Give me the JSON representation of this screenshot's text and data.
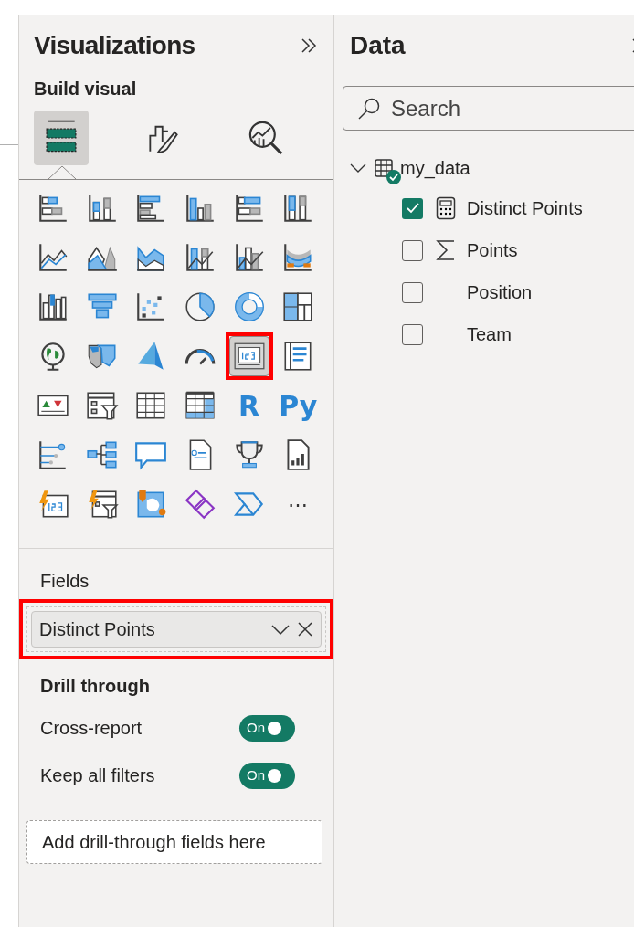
{
  "visualizations": {
    "title": "Visualizations",
    "section": "Build visual",
    "tabs": [
      {
        "kind": "build",
        "selected": true
      },
      {
        "kind": "format",
        "selected": false
      },
      {
        "kind": "analytics",
        "selected": false
      }
    ],
    "visuals": [
      {
        "kind": "stacked-bar",
        "selected": false
      },
      {
        "kind": "stacked-column",
        "selected": false
      },
      {
        "kind": "clustered-bar",
        "selected": false
      },
      {
        "kind": "clustered-column",
        "selected": false
      },
      {
        "kind": "full-bar",
        "selected": false
      },
      {
        "kind": "full-column",
        "selected": false
      },
      {
        "kind": "line",
        "selected": false
      },
      {
        "kind": "area",
        "selected": false
      },
      {
        "kind": "stacked-area",
        "selected": false
      },
      {
        "kind": "line-stacked-column",
        "selected": false
      },
      {
        "kind": "line-clustered-column",
        "selected": false
      },
      {
        "kind": "ribbon",
        "selected": false
      },
      {
        "kind": "waterfall",
        "selected": false
      },
      {
        "kind": "funnel",
        "selected": false
      },
      {
        "kind": "scatter",
        "selected": false
      },
      {
        "kind": "pie",
        "selected": false
      },
      {
        "kind": "donut",
        "selected": false
      },
      {
        "kind": "treemap",
        "selected": false
      },
      {
        "kind": "globe",
        "selected": false
      },
      {
        "kind": "filled-map",
        "selected": false
      },
      {
        "kind": "navigation-arrow",
        "selected": false
      },
      {
        "kind": "gauge",
        "selected": false
      },
      {
        "kind": "card",
        "selected": true,
        "annotated": true
      },
      {
        "kind": "multi-row-card",
        "selected": false
      },
      {
        "kind": "kpi",
        "selected": false
      },
      {
        "kind": "slicer",
        "selected": false
      },
      {
        "kind": "table",
        "selected": false
      },
      {
        "kind": "matrix",
        "selected": false
      },
      {
        "kind": "text",
        "label": "R",
        "selected": false
      },
      {
        "kind": "text",
        "label": "Py",
        "selected": false
      },
      {
        "kind": "key-influencers",
        "selected": false
      },
      {
        "kind": "decomposition-tree",
        "selected": false
      },
      {
        "kind": "speech-bubble",
        "selected": false
      },
      {
        "kind": "narrative-document",
        "selected": false
      },
      {
        "kind": "trophy",
        "selected": false
      },
      {
        "kind": "report-document",
        "selected": false
      },
      {
        "kind": "lightning-card",
        "selected": false
      },
      {
        "kind": "lightning-slicer",
        "selected": false
      },
      {
        "kind": "pin-map",
        "selected": false
      },
      {
        "kind": "diamond",
        "selected": false
      },
      {
        "kind": "chevron-flow",
        "selected": false
      },
      {
        "kind": "more",
        "label": "⋯",
        "selected": false
      }
    ],
    "fields": {
      "label": "Fields",
      "annotated": true,
      "items": [
        {
          "name": "Distinct Points"
        }
      ]
    },
    "drill_through": {
      "title": "Drill through",
      "toggles": [
        {
          "label": "Cross-report",
          "on": true,
          "state_label": "On"
        },
        {
          "label": "Keep all filters",
          "on": true,
          "state_label": "On"
        }
      ],
      "drop_zone": "Add drill-through fields here"
    }
  },
  "data_pane": {
    "title": "Data",
    "search": {
      "placeholder": "Search"
    },
    "tables": [
      {
        "name": "my_data",
        "expanded": true,
        "fields": [
          {
            "name": "Distinct Points",
            "kind": "measure",
            "checked": true
          },
          {
            "name": "Points",
            "kind": "sum",
            "checked": false
          },
          {
            "name": "Position",
            "kind": "column",
            "checked": false
          },
          {
            "name": "Team",
            "kind": "column",
            "checked": false
          }
        ]
      }
    ]
  }
}
